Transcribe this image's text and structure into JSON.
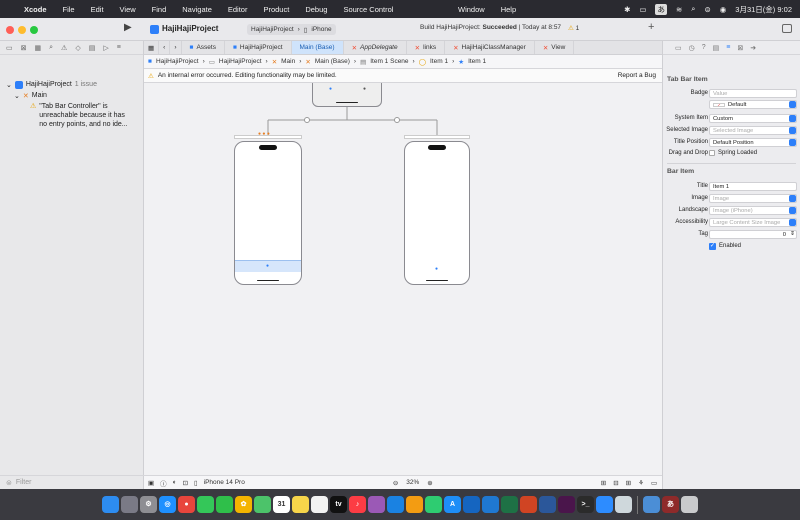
{
  "menubar": {
    "app": "Xcode",
    "items": [
      "File",
      "Edit",
      "View",
      "Find",
      "Navigate",
      "Editor",
      "Product",
      "Debug",
      "Source Control"
    ],
    "center_items": [
      "Window",
      "Help"
    ],
    "input_mode": "あ",
    "clock": "3月31日(金)  9:02"
  },
  "toolbar": {
    "project": "HajiHajiProject",
    "scheme": "HajiHajiProject",
    "device": "iPhone",
    "status_prefix": "Build HajiHajiProject: ",
    "status_result": "Succeeded",
    "status_time": "Today at 8:57",
    "warning_count": "1",
    "add": "+"
  },
  "navigator": {
    "project": "HajiHajiProject",
    "project_issues": "1 issue",
    "file": "Main",
    "issue": "\"Tab Bar Controller\" is unreachable because it has no entry points, and no ide...",
    "filter_placeholder": "Filter"
  },
  "tabs": [
    "Assets",
    "HajiHajiProject",
    "Main (Base)",
    "AppDelegate",
    "links",
    "HajiHajiClassManager",
    "View"
  ],
  "jumpbar": [
    "HajiHajiProject",
    "HajiHajiProject",
    "Main",
    "Main (Base)",
    "Item 1 Scene",
    "Item 1",
    "Item 1"
  ],
  "error_bar": {
    "message": "An internal error occurred. Editing functionality may be limited.",
    "action": "Report a Bug"
  },
  "canvas_bottom": {
    "device": "iPhone 14 Pro",
    "zoom": "32%"
  },
  "inspector": {
    "tab_bar_item": {
      "title": "Tab Bar Item",
      "badge_label": "Badge",
      "badge_placeholder": "Value",
      "color_label": "Default",
      "system_item_label": "System Item",
      "system_item": "Custom",
      "selected_image_label": "Selected Image",
      "selected_image_placeholder": "Selected Image",
      "title_position_label": "Title Position",
      "title_position": "Default Position",
      "drag_drop_label": "Drag and Drop",
      "spring_loaded": "Spring Loaded"
    },
    "bar_item": {
      "title": "Bar Item",
      "title_label": "Title",
      "title_value": "Item 1",
      "image_label": "Image",
      "image_placeholder": "Image",
      "landscape_label": "Landscape",
      "landscape_placeholder": "Image (iPhone)",
      "accessibility_label": "Accessibility",
      "accessibility_placeholder": "Large Content Size Image",
      "tag_label": "Tag",
      "tag_value": "0",
      "enabled": "Enabled"
    }
  },
  "dock": [
    {
      "name": "finder",
      "color": "#2d8cf0",
      "glyph": ""
    },
    {
      "name": "launchpad",
      "color": "#7a7a86",
      "glyph": ""
    },
    {
      "name": "settings",
      "color": "#8e8e93",
      "glyph": "⚙"
    },
    {
      "name": "safari",
      "color": "#1e90ff",
      "glyph": "◎"
    },
    {
      "name": "chrome",
      "color": "#e8453c",
      "glyph": "●"
    },
    {
      "name": "messages",
      "color": "#34c759",
      "glyph": ""
    },
    {
      "name": "facetime",
      "color": "#2fbf4a",
      "glyph": ""
    },
    {
      "name": "photos",
      "color": "#f4b400",
      "glyph": "✿"
    },
    {
      "name": "maps",
      "color": "#4cc36a",
      "glyph": ""
    },
    {
      "name": "calendar",
      "color": "#ffffff",
      "glyph": "31"
    },
    {
      "name": "notes",
      "color": "#f7d54a",
      "glyph": ""
    },
    {
      "name": "reminders",
      "color": "#f2f2f2",
      "glyph": ""
    },
    {
      "name": "tv",
      "color": "#111111",
      "glyph": "tv"
    },
    {
      "name": "music",
      "color": "#fc3c44",
      "glyph": "♪"
    },
    {
      "name": "podcasts",
      "color": "#9b59b6",
      "glyph": ""
    },
    {
      "name": "keynote",
      "color": "#1a82e2",
      "glyph": ""
    },
    {
      "name": "pages",
      "color": "#f39c12",
      "glyph": ""
    },
    {
      "name": "numbers",
      "color": "#2ecc71",
      "glyph": ""
    },
    {
      "name": "appstore",
      "color": "#1e8ef7",
      "glyph": "A"
    },
    {
      "name": "xcode",
      "color": "#1565c0",
      "glyph": ""
    },
    {
      "name": "vscode",
      "color": "#1f78d1",
      "glyph": ""
    },
    {
      "name": "excel",
      "color": "#1e7145",
      "glyph": ""
    },
    {
      "name": "powerpoint",
      "color": "#d04423",
      "glyph": ""
    },
    {
      "name": "word",
      "color": "#2b579a",
      "glyph": ""
    },
    {
      "name": "slack",
      "color": "#4a154b",
      "glyph": ""
    },
    {
      "name": "terminal",
      "color": "#2b2b2b",
      "glyph": ">_"
    },
    {
      "name": "zoom",
      "color": "#2d8cff",
      "glyph": ""
    },
    {
      "name": "preview",
      "color": "#cfd8dc",
      "glyph": ""
    },
    {
      "name": "simulator",
      "color": "#4b8ed6",
      "glyph": ""
    },
    {
      "name": "dictionary",
      "color": "#8e2a2a",
      "glyph": "あ"
    },
    {
      "name": "trash",
      "color": "#c9cacc",
      "glyph": ""
    }
  ]
}
